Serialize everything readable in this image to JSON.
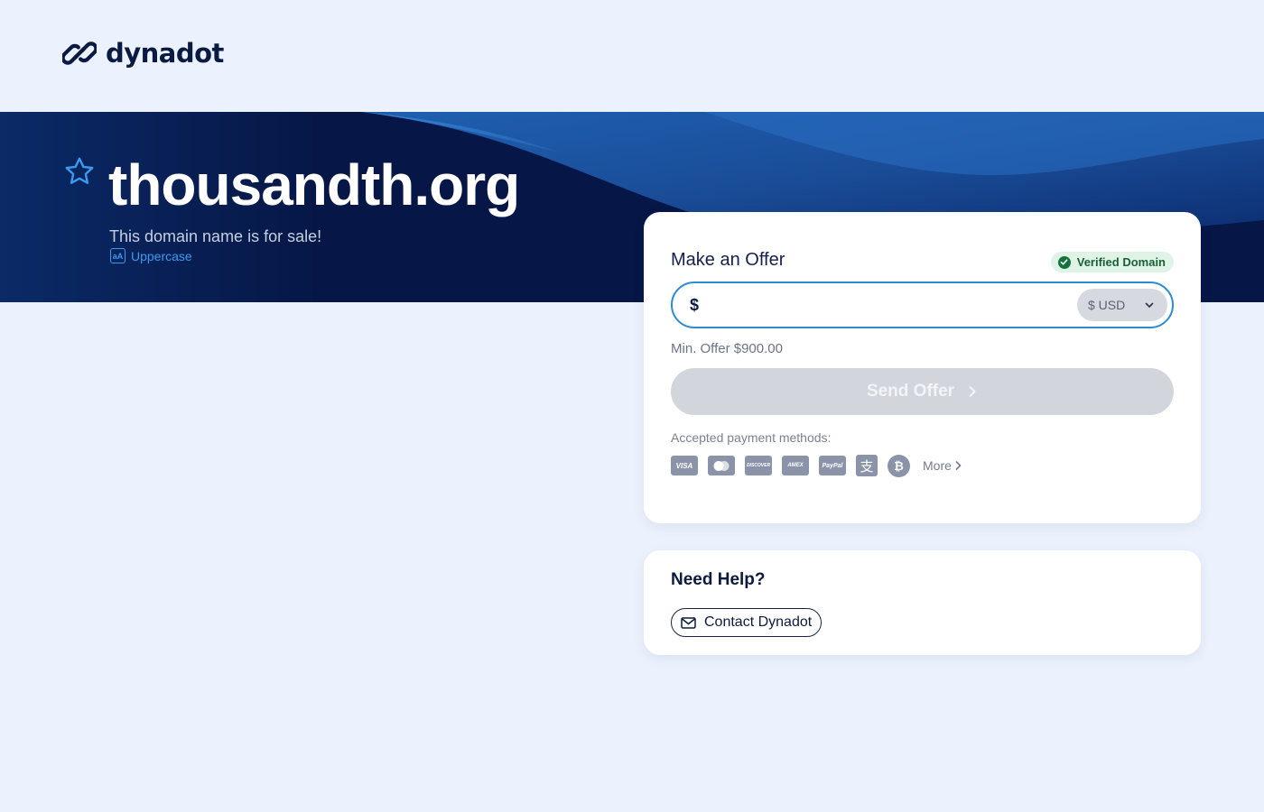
{
  "brand": {
    "name": "dynadot",
    "logo_icon": "link-chain-icon"
  },
  "hero": {
    "domain": "thousandth.org",
    "subtitle": "This domain name is for sale!",
    "case_toggle_label": "Uppercase",
    "case_toggle_icon_text": "aA",
    "favorite_icon": "star-icon"
  },
  "offer": {
    "title": "Make an Offer",
    "verified_label": "Verified Domain",
    "currency_symbol": "$",
    "amount_value": "",
    "currency_label": "$ USD",
    "min_offer_text": "Min. Offer $900.00",
    "send_label": "Send Offer",
    "payment_label": "Accepted payment methods:",
    "payment_methods": {
      "visa": "VISA",
      "mastercard": "●●",
      "discover": "DISCOVER",
      "amex": "AMEX",
      "paypal": "PayPal",
      "alipay": "支",
      "bitcoin": "₿"
    },
    "more_label": "More"
  },
  "help": {
    "title": "Need Help?",
    "contact_label": "Contact Dynadot"
  },
  "colors": {
    "page_bg": "#ebf2fd",
    "hero_bg": "#061747",
    "accent_blue": "#2b8bd3",
    "verified_green": "#14743b",
    "button_disabled": "#d2d5dc"
  }
}
